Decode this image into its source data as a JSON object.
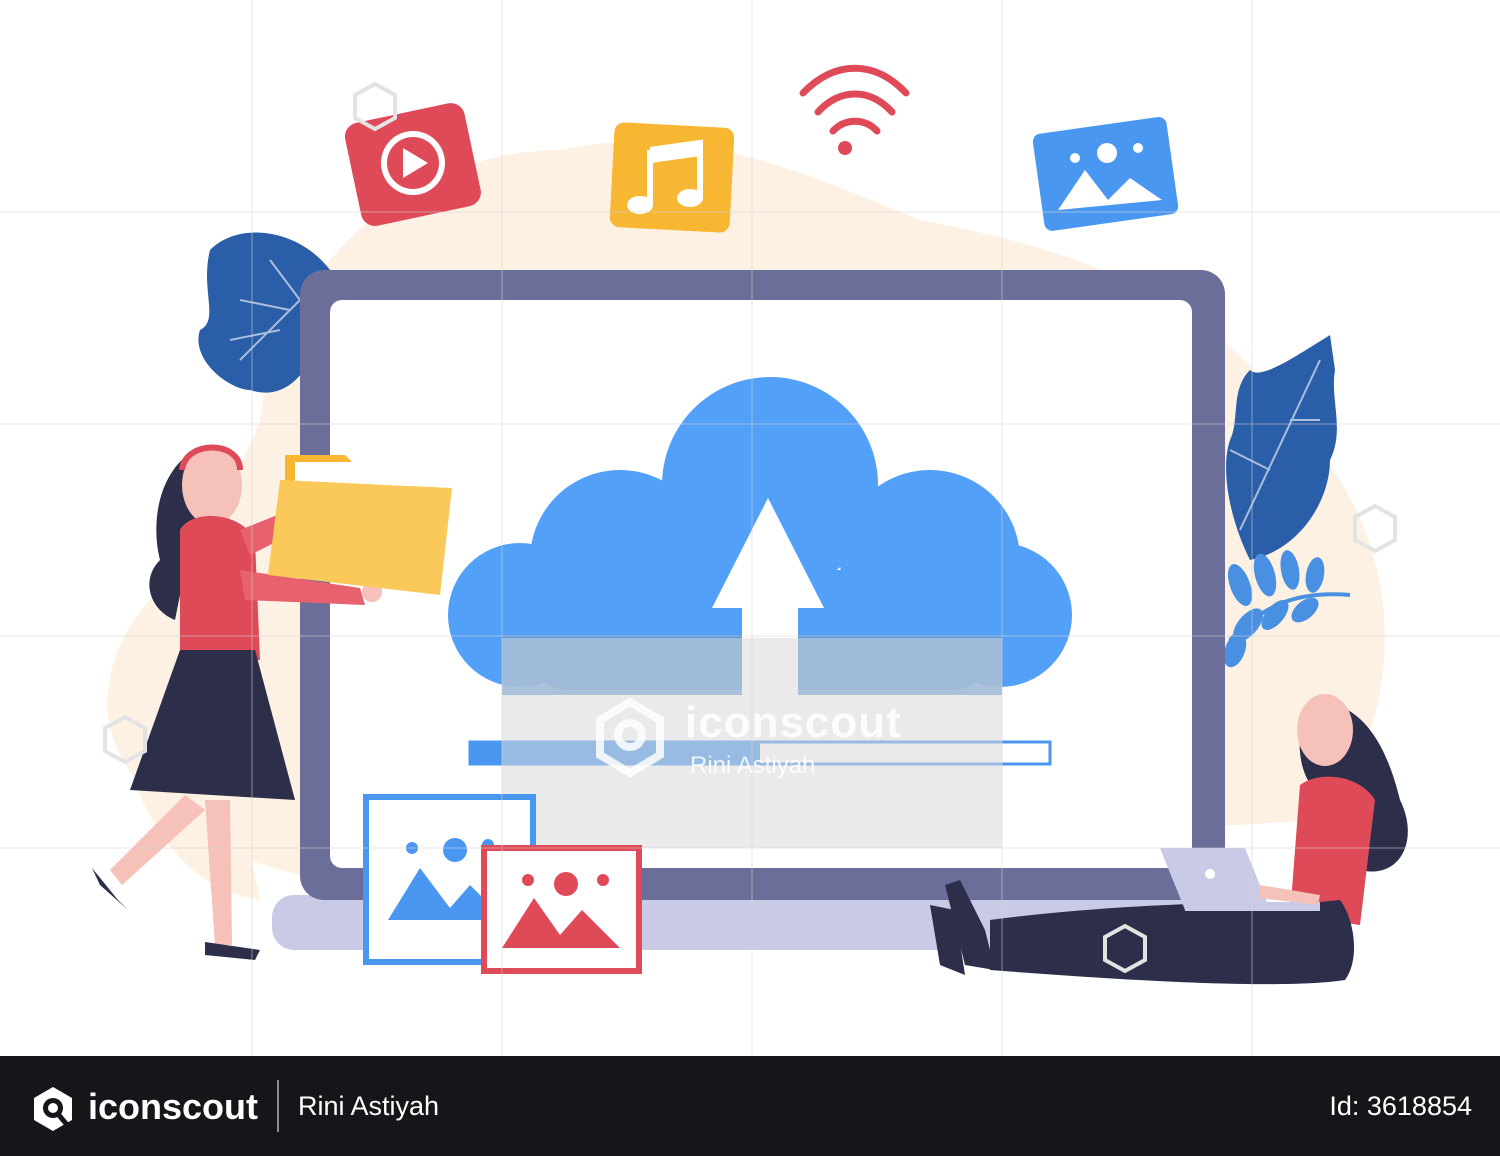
{
  "watermark": {
    "brand": "iconscout",
    "author": "Rini Astiyah"
  },
  "footer": {
    "brand": "iconscout",
    "author": "Rini Astiyah",
    "id_text": "Id: 3618854"
  },
  "upload": {
    "progress_fraction": 0.5
  },
  "colors": {
    "cloud": "#52a0f8",
    "screen_frame": "#6c6e9a",
    "laptop_base": "#c8cae6",
    "leaf": "#2a5ea8",
    "accent_red": "#df4a58",
    "folder_yellow": "#f9c74f",
    "photo_blue": "#4a97f2",
    "footer_bg": "#15161a"
  },
  "icons": [
    "video-play-icon",
    "music-note-icon",
    "wifi-icon",
    "image-icon",
    "folder-icon",
    "upload-arrow-icon",
    "laptop-icon"
  ]
}
